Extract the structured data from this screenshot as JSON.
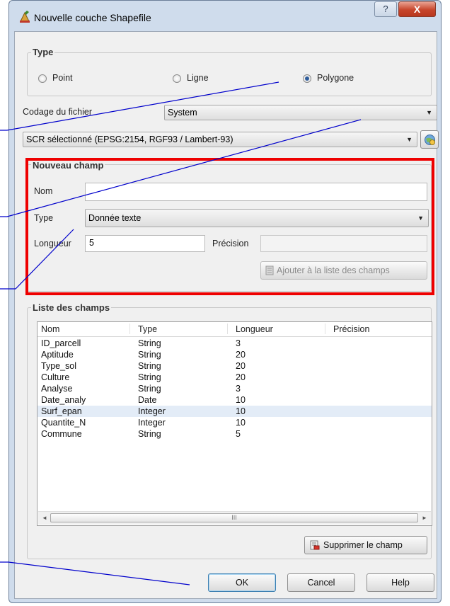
{
  "window": {
    "title": "Nouvelle couche Shapefile",
    "help_label": "?",
    "close_label": "X"
  },
  "type_group": {
    "title": "Type",
    "options": [
      "Point",
      "Ligne",
      "Polygone"
    ],
    "selected": "Polygone"
  },
  "encoding": {
    "label": "Codage du fichier",
    "value": "System"
  },
  "crs": {
    "value": "SCR sélectionné (EPSG:2154, RGF93 / Lambert-93)"
  },
  "new_field": {
    "title": "Nouveau champ",
    "name_label": "Nom",
    "name_value": "",
    "type_label": "Type",
    "type_value": "Donnée texte",
    "length_label": "Longueur",
    "length_value": "5",
    "precision_label": "Précision",
    "precision_value": "",
    "add_button": "Ajouter à la liste des champs"
  },
  "field_list": {
    "title": "Liste des champs",
    "columns": [
      "Nom",
      "Type",
      "Longueur",
      "Précision"
    ],
    "rows": [
      [
        "ID_parcell",
        "String",
        "3",
        ""
      ],
      [
        "Aptitude",
        "String",
        "20",
        ""
      ],
      [
        "Type_sol",
        "String",
        "20",
        ""
      ],
      [
        "Culture",
        "String",
        "20",
        ""
      ],
      [
        "Analyse",
        "String",
        "3",
        ""
      ],
      [
        "Date_analy",
        "Date",
        "10",
        ""
      ],
      [
        "Surf_epan",
        "Integer",
        "10",
        ""
      ],
      [
        "Quantite_N",
        "Integer",
        "10",
        ""
      ],
      [
        "Commune",
        "String",
        "5",
        ""
      ]
    ],
    "scroll_left": "◄",
    "scroll_right": "►",
    "scroll_grip": "III",
    "delete_button": "Supprimer le champ"
  },
  "buttons": {
    "ok": "OK",
    "cancel": "Cancel",
    "help": "Help"
  },
  "colors": {
    "highlight_box": "#ee0000",
    "annotation_lines": "#0000cc"
  },
  "icons": {
    "app": "shapefile-layer-icon",
    "crs": "crs-select-icon",
    "add_field": "add-field-icon",
    "delete_field": "delete-field-icon"
  }
}
